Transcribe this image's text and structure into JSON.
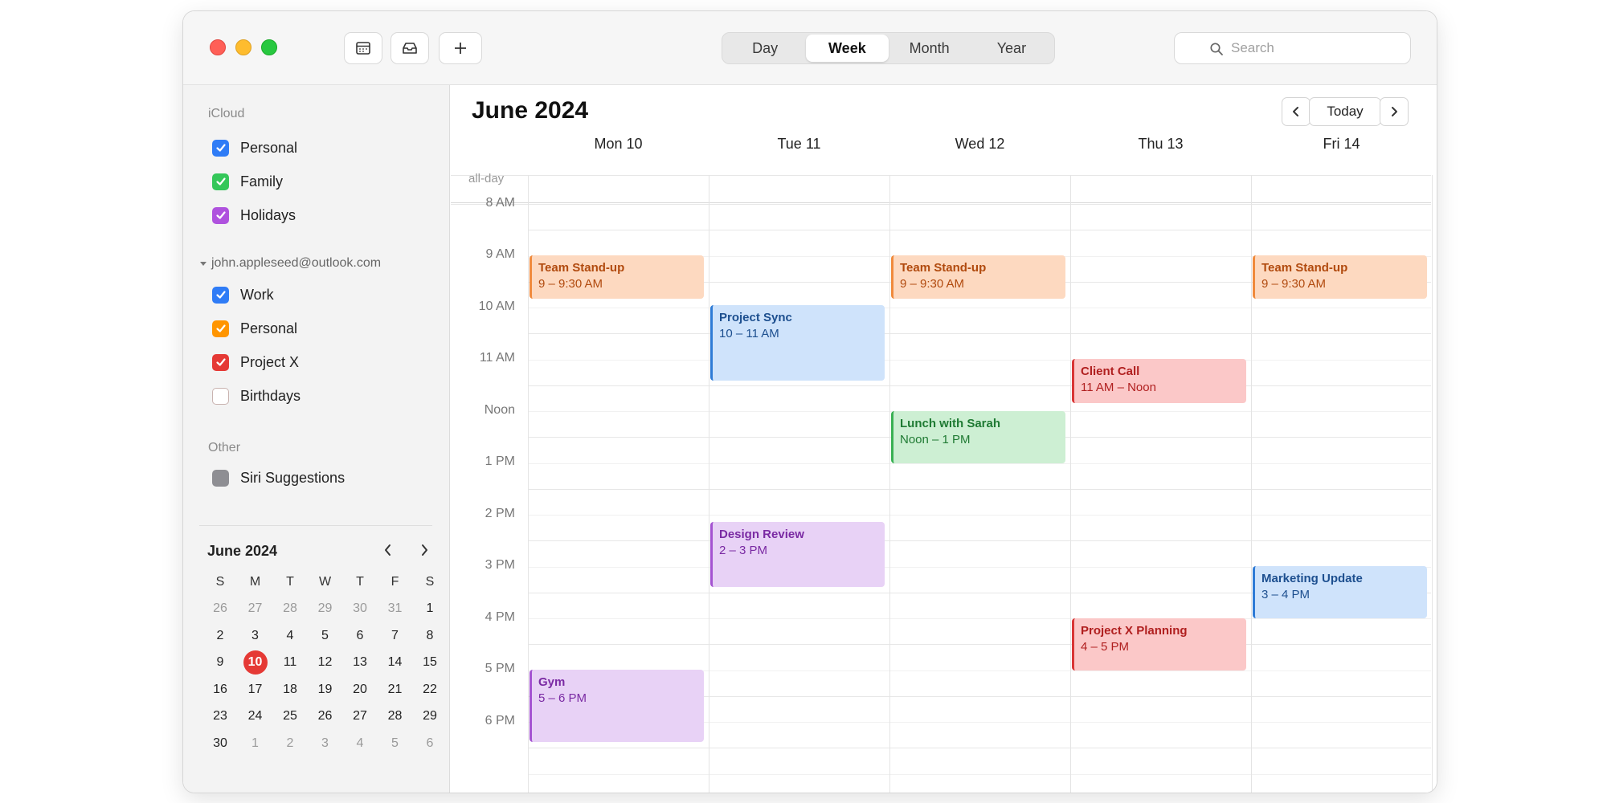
{
  "toolbar": {
    "views": [
      "Day",
      "Week",
      "Month",
      "Year"
    ],
    "active_view": "Week",
    "search_placeholder": "Search"
  },
  "sidebar": {
    "icloud_label": "iCloud",
    "icloud": [
      {
        "label": "Personal",
        "color": "#2f7cf6",
        "checked": true
      },
      {
        "label": "Family",
        "color": "#34c759",
        "checked": true
      },
      {
        "label": "Holidays",
        "color": "#af52de",
        "checked": true
      }
    ],
    "account_label": "john.appleseed@outlook.com",
    "account": [
      {
        "label": "Work",
        "color": "#2f7cf6",
        "checked": true
      },
      {
        "label": "Personal",
        "color": "#ff9500",
        "checked": true
      },
      {
        "label": "Project X",
        "color": "#e53935",
        "checked": true
      },
      {
        "label": "Birthdays",
        "color": "#ffffff",
        "checked": false
      }
    ],
    "other_label": "Other",
    "other": [
      {
        "label": "Siri Suggestions",
        "color": "#8e8e93",
        "checked": false
      }
    ]
  },
  "mini_calendar": {
    "title": "June 2024",
    "weekdays": [
      "S",
      "M",
      "T",
      "W",
      "T",
      "F",
      "S"
    ],
    "weeks": [
      [
        "26",
        "27",
        "28",
        "29",
        "30",
        "31",
        "1"
      ],
      [
        "2",
        "3",
        "4",
        "5",
        "6",
        "7",
        "8"
      ],
      [
        "9",
        "10",
        "11",
        "12",
        "13",
        "14",
        "15"
      ],
      [
        "16",
        "17",
        "18",
        "19",
        "20",
        "21",
        "22"
      ],
      [
        "23",
        "24",
        "25",
        "26",
        "27",
        "28",
        "29"
      ],
      [
        "30",
        "1",
        "2",
        "3",
        "4",
        "5",
        "6"
      ]
    ],
    "today": "10"
  },
  "week": {
    "title": "June 2024",
    "today_label": "Today",
    "allday_label": "all-day",
    "days": [
      "Mon 10",
      "Tue 11",
      "Wed 12",
      "Thu 13",
      "Fri 14"
    ],
    "hours": [
      "8 AM",
      "9 AM",
      "10 AM",
      "11 AM",
      "Noon",
      "1 PM",
      "2 PM",
      "3 PM",
      "4 PM",
      "5 PM",
      "6 PM"
    ],
    "events": [
      {
        "title": "Team Stand-up",
        "time": "9 – 9:30 AM",
        "day": 0,
        "start": 9,
        "end": 9.83,
        "color": "orange"
      },
      {
        "title": "Team Stand-up",
        "time": "9 – 9:30 AM",
        "day": 2,
        "start": 9,
        "end": 9.83,
        "color": "orange"
      },
      {
        "title": "Team Stand-up",
        "time": "9 – 9:30 AM",
        "day": 4,
        "start": 9,
        "end": 9.83,
        "color": "orange"
      },
      {
        "title": "Project Sync",
        "time": "10 – 11 AM",
        "day": 1,
        "start": 9.95,
        "end": 11.4,
        "color": "blue"
      },
      {
        "title": "Client Call",
        "time": "11 AM – Noon",
        "day": 3,
        "start": 11,
        "end": 11.85,
        "color": "red"
      },
      {
        "title": "Lunch with Sarah",
        "time": "Noon – 1 PM",
        "day": 2,
        "start": 12,
        "end": 13,
        "color": "green"
      },
      {
        "title": "Design Review",
        "time": "2 – 3 PM",
        "day": 1,
        "start": 14.15,
        "end": 15.4,
        "color": "purple"
      },
      {
        "title": "Marketing Update",
        "time": "3 – 4 PM",
        "day": 4,
        "start": 15,
        "end": 16,
        "color": "blue"
      },
      {
        "title": "Project X Planning",
        "time": "4 – 5 PM",
        "day": 3,
        "start": 16,
        "end": 17,
        "color": "red"
      },
      {
        "title": "Gym",
        "time": "5 – 6 PM",
        "day": 0,
        "start": 17,
        "end": 18.4,
        "color": "purple"
      }
    ]
  }
}
